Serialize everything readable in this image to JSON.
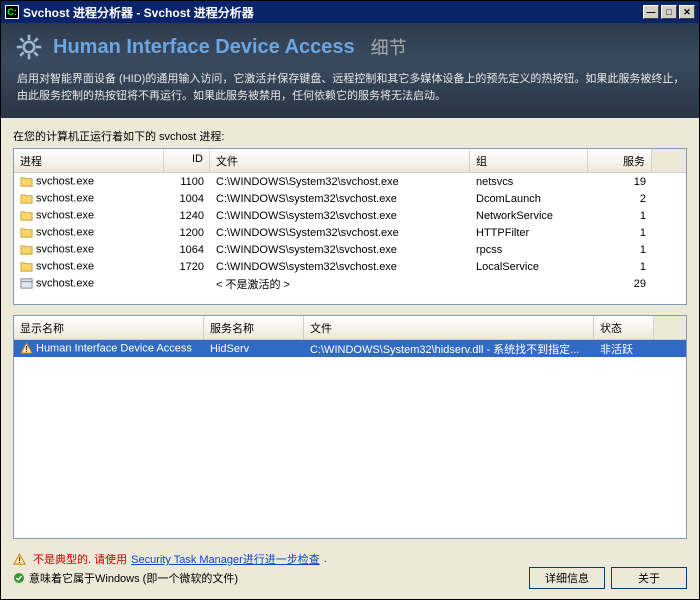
{
  "titlebar": {
    "text": "Svchost 进程分析器 - Svchost 进程分析器"
  },
  "header": {
    "title": "Human Interface Device Access",
    "subtitle": "细节",
    "desc": "启用对智能界面设备 (HID)的通用输入访问，它激活并保存键盘、远程控制和其它多媒体设备上的预先定义的热按钮。如果此服务被终止，由此服务控制的热按钮将不再运行。如果此服务被禁用，任何依赖它的服务将无法启动。"
  },
  "process_section": {
    "label": "在您的计算机正运行着如下的 svchost 进程:",
    "columns": {
      "name": "进程",
      "id": "ID",
      "file": "文件",
      "group": "组",
      "services": "服务"
    },
    "rows": [
      {
        "icon": "folder",
        "name": "svchost.exe",
        "id": "1100",
        "file": "C:\\WINDOWS\\System32\\svchost.exe",
        "group": "netsvcs",
        "services": "19"
      },
      {
        "icon": "folder",
        "name": "svchost.exe",
        "id": "1004",
        "file": "C:\\WINDOWS\\system32\\svchost.exe",
        "group": "DcomLaunch",
        "services": "2"
      },
      {
        "icon": "folder",
        "name": "svchost.exe",
        "id": "1240",
        "file": "C:\\WINDOWS\\system32\\svchost.exe",
        "group": "NetworkService",
        "services": "1"
      },
      {
        "icon": "folder",
        "name": "svchost.exe",
        "id": "1200",
        "file": "C:\\WINDOWS\\System32\\svchost.exe",
        "group": "HTTPFilter",
        "services": "1"
      },
      {
        "icon": "folder",
        "name": "svchost.exe",
        "id": "1064",
        "file": "C:\\WINDOWS\\system32\\svchost.exe",
        "group": "rpcss",
        "services": "1"
      },
      {
        "icon": "folder",
        "name": "svchost.exe",
        "id": "1720",
        "file": "C:\\WINDOWS\\system32\\svchost.exe",
        "group": "LocalService",
        "services": "1"
      },
      {
        "icon": "app",
        "name": "svchost.exe",
        "id": "",
        "file": "< 不是激活的 >",
        "group": "",
        "services": "29"
      }
    ]
  },
  "service_section": {
    "columns": {
      "disp": "显示名称",
      "name": "服务名称",
      "file": "文件",
      "state": "状态"
    },
    "rows": [
      {
        "selected": true,
        "disp": "Human Interface Device Access",
        "name": "HidServ",
        "file": "C:\\WINDOWS\\System32\\hidserv.dll - 系统找不到指定...",
        "state": "非活跃"
      }
    ]
  },
  "footer": {
    "warn_prefix": "不是典型的. 请使用",
    "warn_link": "Security Task Manager进行进一步检查",
    "warn_suffix": ".",
    "ok_text": "意味着它属于Windows (即一个微软的文件)",
    "btn_detail": "详细信息",
    "btn_about": "关于"
  }
}
